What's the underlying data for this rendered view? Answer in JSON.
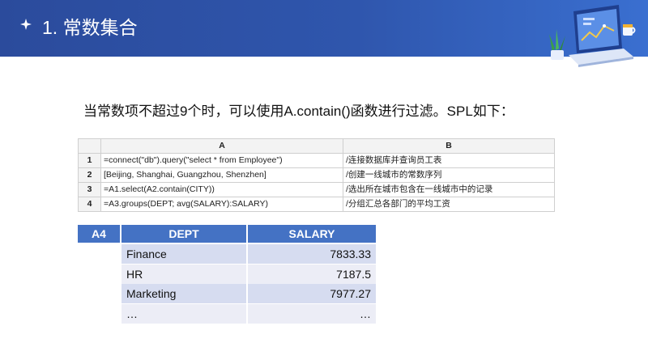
{
  "header": {
    "title": "1. 常数集合",
    "icon": "sparkle-icon"
  },
  "description": "当常数项不超过9个时，可以使用A.contain()函数进行过滤。SPL如下：",
  "code_table": {
    "columns": [
      "A",
      "B"
    ],
    "rows": [
      {
        "num": "1",
        "a": "=connect(\"db\").query(\"select * from Employee\")",
        "b": "/连接数据库并查询员工表"
      },
      {
        "num": "2",
        "a": "[Beijing, Shanghai, Guangzhou, Shenzhen]",
        "b": "/创建一线城市的常数序列"
      },
      {
        "num": "3",
        "a": "=A1.select(A2.contain(CITY))",
        "b": "/选出所在城市包含在一线城市中的记录"
      },
      {
        "num": "4",
        "a": "=A3.groups(DEPT; avg(SALARY):SALARY)",
        "b": "/分组汇总各部门的平均工资"
      }
    ]
  },
  "result_table": {
    "label": "A4",
    "columns": [
      "DEPT",
      "SALARY"
    ],
    "rows": [
      {
        "dept": "Finance",
        "salary": "7833.33"
      },
      {
        "dept": "HR",
        "salary": "7187.5"
      },
      {
        "dept": "Marketing",
        "salary": "7977.27"
      },
      {
        "dept": "…",
        "salary": "…"
      }
    ]
  },
  "colors": {
    "header_bg": "#2f56ad",
    "result_header": "#4472c4",
    "row_odd": "#d6dcf0",
    "row_even": "#ecedf6"
  }
}
